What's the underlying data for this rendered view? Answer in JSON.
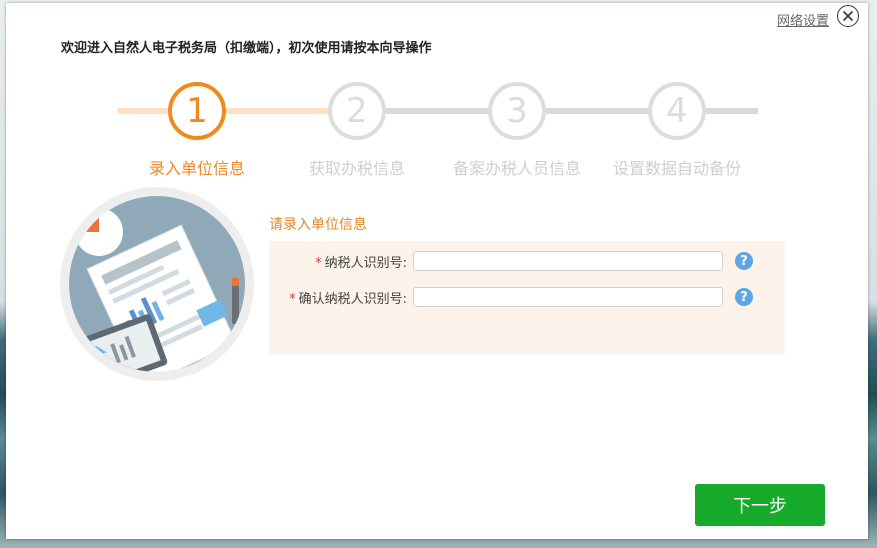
{
  "header": {
    "network_settings_link": "网络设置",
    "close_icon": "close-icon",
    "welcome_text": "欢迎进入自然人电子税务局（扣缴端），初次使用请按本向导操作"
  },
  "steps": [
    {
      "number": "1",
      "label": "录入单位信息",
      "active": true
    },
    {
      "number": "2",
      "label": "获取办税信息",
      "active": false
    },
    {
      "number": "3",
      "label": "备案办税人员信息",
      "active": false
    },
    {
      "number": "4",
      "label": "设置数据自动备份",
      "active": false
    }
  ],
  "form": {
    "title": "请录入单位信息",
    "required_mark": "*",
    "fields": [
      {
        "label": "纳税人识别号:",
        "value": "",
        "help": "?"
      },
      {
        "label": "确认纳税人识别号:",
        "value": "",
        "help": "?"
      }
    ]
  },
  "footer": {
    "next_label": "下一步"
  },
  "colors": {
    "accent": "#f08a1c",
    "inactive": "#dcdcdc",
    "primary_button": "#16ab2b",
    "help_icon": "#5ea6e6"
  }
}
